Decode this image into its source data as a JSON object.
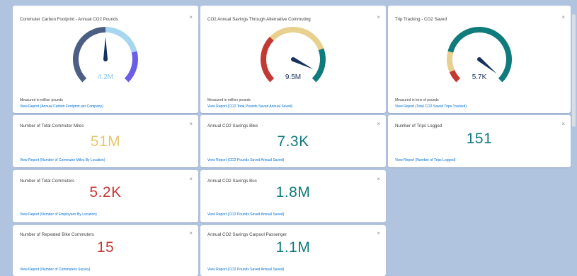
{
  "gauges": [
    {
      "title": "Commuter Carbon Footprint - Annual CO2 Pounds",
      "value": "4.2M",
      "value_color": "#8ec8e8",
      "measure": "Measured in million pounds",
      "link": "View Report (Annual Carbon Footprint per Company)",
      "level": 0.5,
      "segments": [
        {
          "color": "#4b5f85",
          "from": 0,
          "to": 0.5
        },
        {
          "color": "#a7d6f0",
          "from": 0.5,
          "to": 0.78
        },
        {
          "color": "#6a5ee8",
          "from": 0.78,
          "to": 1
        }
      ],
      "needle_color": "#16325c"
    },
    {
      "title": "CO2 Annual Savings Through Alternative Commuting",
      "value": "9.5M",
      "value_color": "#16325c",
      "measure": "Measured in million pounds",
      "link": "View Report (CO2 Total Pounds Saved Annual Saved)",
      "level": 0.93,
      "segments": [
        {
          "color": "#c23934",
          "from": 0,
          "to": 0.33
        },
        {
          "color": "#e8d08e",
          "from": 0.33,
          "to": 0.76
        },
        {
          "color": "#0f7b7a",
          "from": 0.76,
          "to": 1
        }
      ],
      "needle_color": "#16325c"
    },
    {
      "title": "Trip Tracking - CO2 Saved",
      "value": "5.7K",
      "value_color": "#16325c",
      "measure": "Measured in tons of pounds",
      "link": "View Report (Total CO2 Saved Trips Tracked)",
      "level": 0.98,
      "segments": [
        {
          "color": "#c23934",
          "from": 0,
          "to": 0.08
        },
        {
          "color": "#e8d08e",
          "from": 0.08,
          "to": 0.22
        },
        {
          "color": "#0f7b7a",
          "from": 0.22,
          "to": 1
        }
      ],
      "needle_color": "#16325c"
    }
  ],
  "metrics": [
    {
      "title": "Number of Total Commuter Miles",
      "value": "51M",
      "link": "View Report (Number of Commuter Miles By Location)"
    },
    {
      "title": "Annual CO2 Savings Bike",
      "value": "7.3K",
      "link": "View Report (CO2 Pounds Saved Annual Saved)"
    },
    {
      "title": "Number of Trips Logged",
      "value": "151",
      "link": "View Report (Number of Trips Logged)"
    },
    {
      "title": "Number of Total Commuters",
      "value": "5.2K",
      "link": "View Report (Number of Employees By Location)"
    },
    {
      "title": "Annual CO2 Savings Bus",
      "value": "1.8M",
      "link": "View Report (CO2 Pounds Saved Annual Saved)"
    },
    {
      "title": "Number of Repeated Bike Commuters",
      "value": "15",
      "link": "View Report (Number of Commuters Survey)"
    },
    {
      "title": "Annual CO2 Savings Carpool Passenger",
      "value": "1.1M",
      "link": "View Report (CO2 Pounds Saved Annual Saved)"
    }
  ],
  "close_label": "×",
  "icons": {
    "close": "close-icon",
    "needle": "needle-icon"
  }
}
